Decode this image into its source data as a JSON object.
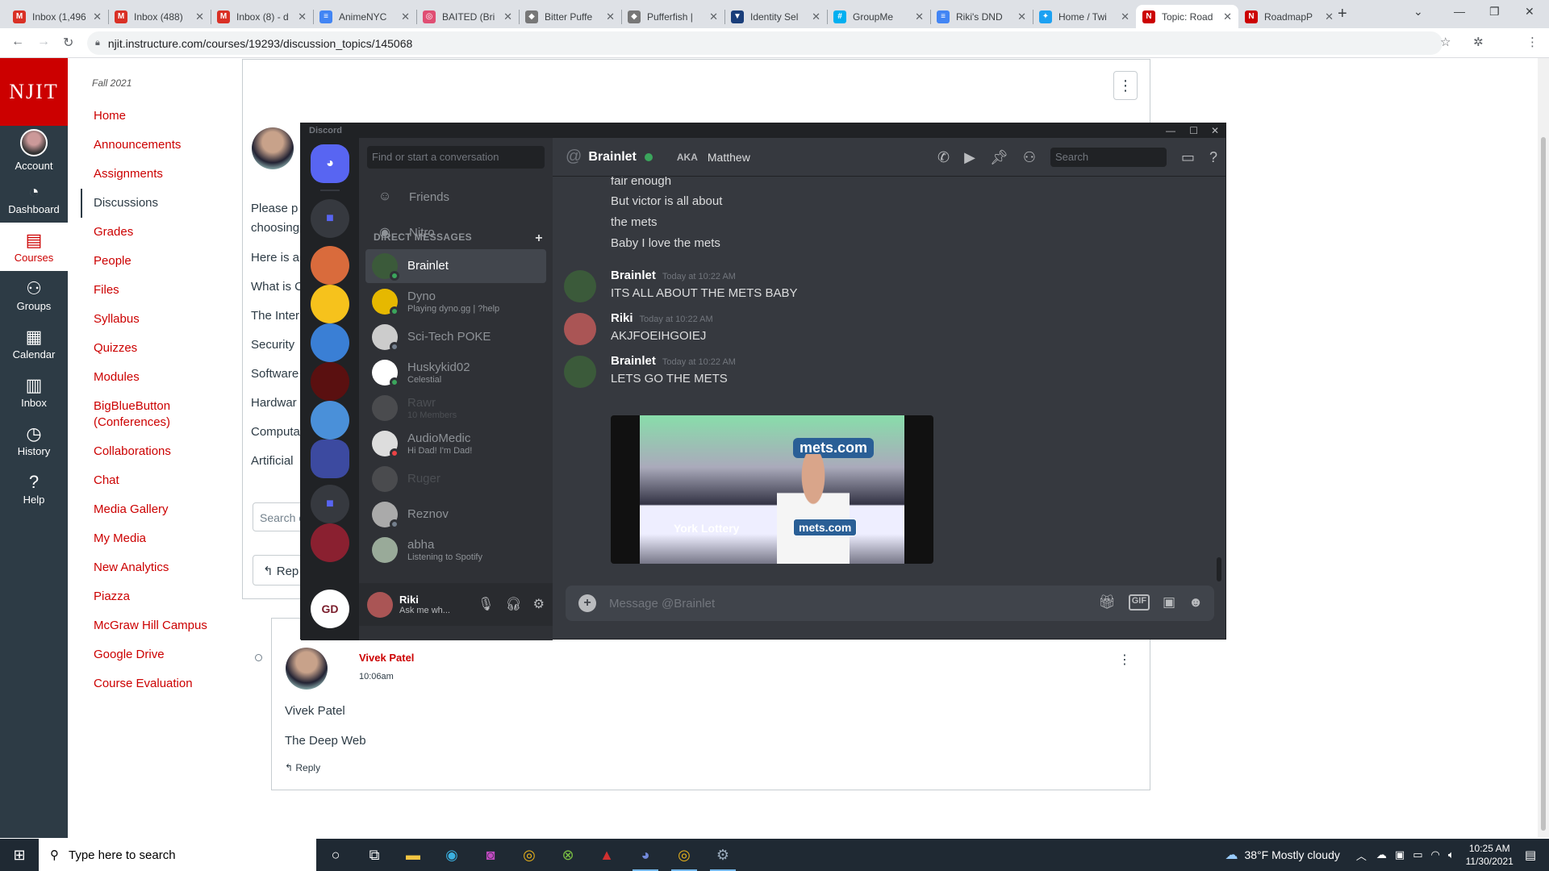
{
  "browser": {
    "tabs": [
      {
        "label": "Inbox (1,496",
        "color": "#d93025",
        "icon": "gmail-icon",
        "glyph": "M"
      },
      {
        "label": "Inbox (488)",
        "color": "#d93025",
        "icon": "gmail-icon",
        "glyph": "M"
      },
      {
        "label": "Inbox (8) - d",
        "color": "#d93025",
        "icon": "gmail-icon",
        "glyph": "M"
      },
      {
        "label": "AnimeNYC",
        "color": "#4285f4",
        "icon": "docs-icon",
        "glyph": "≡"
      },
      {
        "label": "BAITED (Bri",
        "color": "#e04e73",
        "icon": "site-icon",
        "glyph": "◎"
      },
      {
        "label": "Bitter Puffe",
        "color": "#777",
        "icon": "fish-icon",
        "glyph": "◆"
      },
      {
        "label": "Pufferfish |",
        "color": "#777",
        "icon": "fish-icon",
        "glyph": "◆"
      },
      {
        "label": "Identity Sel",
        "color": "#1a3e7a",
        "icon": "shield-icon",
        "glyph": "▼"
      },
      {
        "label": "GroupMe",
        "color": "#00aff0",
        "icon": "groupme-icon",
        "glyph": "#"
      },
      {
        "label": "Riki's DND",
        "color": "#4285f4",
        "icon": "docs-icon",
        "glyph": "≡"
      },
      {
        "label": "Home / Twi",
        "color": "#1da1f2",
        "icon": "twitter-icon",
        "glyph": "✦"
      },
      {
        "label": "Topic: Road",
        "color": "#cc0000",
        "icon": "canvas-icon",
        "glyph": "N"
      },
      {
        "label": "RoadmapP",
        "color": "#cc0000",
        "icon": "canvas-icon",
        "glyph": "N"
      }
    ],
    "active_tab": 11,
    "url": "njit.instructure.com/courses/19293/discussion_topics/145068"
  },
  "global_nav": {
    "logo": "NJIT",
    "items": [
      {
        "label": "Account",
        "icon": "avatar"
      },
      {
        "label": "Dashboard",
        "icon": "dashboard-icon",
        "glyph": "◔"
      },
      {
        "label": "Courses",
        "icon": "courses-icon",
        "glyph": "▤"
      },
      {
        "label": "Groups",
        "icon": "groups-icon",
        "glyph": "⚇"
      },
      {
        "label": "Calendar",
        "icon": "calendar-icon",
        "glyph": "▦"
      },
      {
        "label": "Inbox",
        "icon": "inbox-icon",
        "glyph": "▥"
      },
      {
        "label": "History",
        "icon": "history-icon",
        "glyph": "◷"
      },
      {
        "label": "Help",
        "icon": "help-icon",
        "glyph": "?"
      }
    ],
    "active": "Courses"
  },
  "course_nav": {
    "term": "Fall 2021",
    "items": [
      "Home",
      "Announcements",
      "Assignments",
      "Discussions",
      "Grades",
      "People",
      "Files",
      "Syllabus",
      "Quizzes",
      "Modules",
      "BigBlueButton (Conferences)",
      "Collaborations",
      "Chat",
      "Media Gallery",
      "My Media",
      "New Analytics",
      "Piazza",
      "McGraw Hill Campus",
      "Google Drive",
      "Course Evaluation"
    ],
    "active": "Discussions"
  },
  "discussion": {
    "body_fragments": [
      "Please p",
      "choosing",
      "Here is a",
      "What is C",
      "The Inter",
      "Security",
      "Software",
      "Hardwar",
      "Computa",
      "Artificial"
    ],
    "search_placeholder": "Search e",
    "reply_label": "Rep",
    "reply": {
      "author": "Vivek Patel",
      "time": "10:06am",
      "lines": [
        "Vivek Patel",
        "The Deep Web"
      ],
      "reply_label": "Reply"
    }
  },
  "discord": {
    "app_name": "Discord",
    "search_placeholder": "Find or start a conversation",
    "nav": [
      {
        "label": "Friends",
        "icon": "friends-icon",
        "glyph": "☺"
      },
      {
        "label": "Nitro",
        "icon": "nitro-icon",
        "glyph": "◉"
      }
    ],
    "dm_header": "DIRECT MESSAGES",
    "dms": [
      {
        "name": "Brainlet",
        "sub": "",
        "color": "#3b5a3a",
        "status": "#3ba55c",
        "active": true,
        "dim": false
      },
      {
        "name": "Dyno",
        "sub": "Playing dyno.gg | ?help",
        "color": "#e6b800",
        "status": "#3ba55c",
        "active": false,
        "dim": false
      },
      {
        "name": "Sci-Tech POKE",
        "sub": "",
        "color": "#ccc",
        "status": "#747f8d",
        "active": false,
        "dim": false
      },
      {
        "name": "Huskykid02",
        "sub": "Celestial",
        "color": "#fff",
        "status": "#3ba55c",
        "active": false,
        "dim": false
      },
      {
        "name": "Rawr",
        "sub": "10 Members",
        "color": "#888",
        "status": "",
        "active": false,
        "dim": true
      },
      {
        "name": "AudioMedic",
        "sub": "Hi Dad! I'm Dad!",
        "color": "#ddd",
        "status": "#ed4245",
        "active": false,
        "dim": false
      },
      {
        "name": "Ruger",
        "sub": "",
        "color": "#888",
        "status": "",
        "active": false,
        "dim": true
      },
      {
        "name": "Reznov",
        "sub": "",
        "color": "#aaa",
        "status": "#747f8d",
        "active": false,
        "dim": false
      },
      {
        "name": "abha",
        "sub": "Listening to Spotify",
        "color": "#9a9",
        "status": "",
        "active": false,
        "dim": false
      }
    ],
    "user": {
      "name": "Riki",
      "status": "Ask me wh..."
    },
    "channel": {
      "name": "Brainlet",
      "aka_label": "AKA",
      "aka": "Matthew",
      "search_placeholder": "Search"
    },
    "loose_lines": [
      "fair enough",
      "But victor is all about",
      "the mets",
      "Baby I love the mets"
    ],
    "messages": [
      {
        "author": "Brainlet",
        "time": "Today at 10:22 AM",
        "text": "ITS ALL ABOUT THE METS BABY",
        "color": "#3b5a3a"
      },
      {
        "author": "Riki",
        "time": "Today at 10:22 AM",
        "text": "AKJFOEIHGOIEJ",
        "color": "#a55"
      },
      {
        "author": "Brainlet",
        "time": "Today at 10:22 AM",
        "text": "LETS GO THE METS",
        "color": "#3b5a3a"
      }
    ],
    "gif": {
      "sign1": "mets.com",
      "sign2": "mets.com",
      "banner": "York Lottery"
    },
    "composer_placeholder": "Message @Brainlet"
  },
  "taskbar": {
    "search_placeholder": "Type here to search",
    "weather": "38°F  Mostly cloudy",
    "time": "10:25 AM",
    "date": "11/30/2021"
  }
}
